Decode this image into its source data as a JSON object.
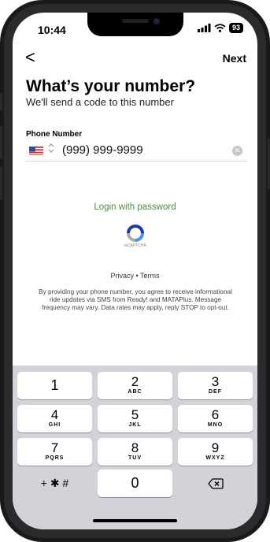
{
  "status": {
    "time": "10:44",
    "battery": "93"
  },
  "nav": {
    "back": "<",
    "next": "Next"
  },
  "header": {
    "title": "What’s your number?",
    "subtitle": "We'll send a code to this number"
  },
  "phone": {
    "label": "Phone Number",
    "placeholder": "(999) 999-9999",
    "country_flag": "us-flag-icon"
  },
  "login_with_password": "Login with password",
  "recaptcha": {
    "label": "reCAPTCHA"
  },
  "legal": {
    "privacy": "Privacy",
    "separator": "•",
    "terms": "Terms"
  },
  "consent_text": "By providing your phone number, you agree to receive informational ride updates via SMS from Ready! and MATAPlus. Message frequency may vary. Data rates may apply, reply STOP to opt-out.",
  "keypad": {
    "keys": [
      {
        "num": "1",
        "letters": ""
      },
      {
        "num": "2",
        "letters": "ABC"
      },
      {
        "num": "3",
        "letters": "DEF"
      },
      {
        "num": "4",
        "letters": "GHI"
      },
      {
        "num": "5",
        "letters": "JKL"
      },
      {
        "num": "6",
        "letters": "MNO"
      },
      {
        "num": "7",
        "letters": "PQRS"
      },
      {
        "num": "8",
        "letters": "TUV"
      },
      {
        "num": "9",
        "letters": "WXYZ"
      },
      {
        "num": "0",
        "letters": ""
      }
    ],
    "symbols": "+ ✱ #",
    "delete": "⌫"
  },
  "colors": {
    "accent_green": "#4c8b3a",
    "keyboard_bg": "#d1d3d9"
  }
}
